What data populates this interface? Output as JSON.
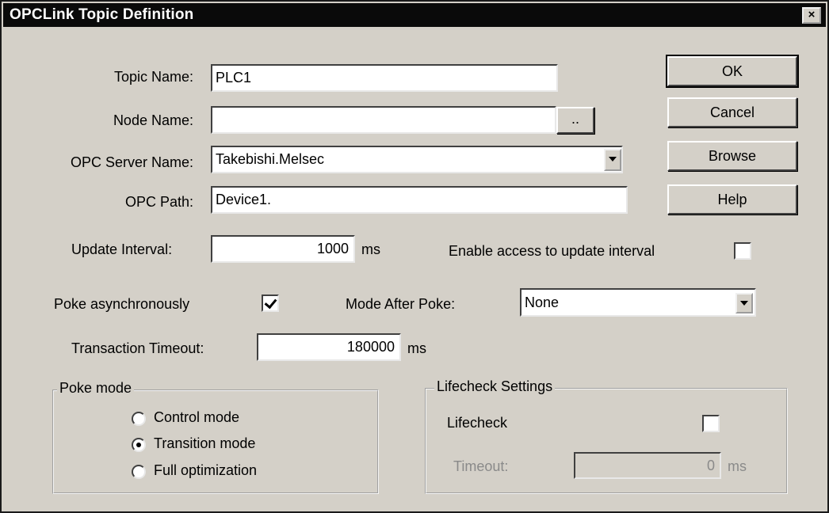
{
  "window": {
    "title": "OPCLink Topic Definition",
    "close_glyph": "×"
  },
  "fields": {
    "topic_name": {
      "label": "Topic Name:",
      "value": "PLC1"
    },
    "node_name": {
      "label": "Node Name:",
      "value": "",
      "browse_label": ".."
    },
    "opc_server_name": {
      "label": "OPC Server Name:",
      "value": "Takebishi.Melsec"
    },
    "opc_path": {
      "label": "OPC Path:",
      "value": "Device1."
    },
    "update_interval": {
      "label": "Update Interval:",
      "value": "1000",
      "unit": "ms"
    },
    "enable_access": {
      "label": "Enable access to update interval",
      "checked": false
    },
    "poke_async": {
      "label": "Poke asynchronously",
      "checked": true
    },
    "mode_after_poke": {
      "label": "Mode After Poke:",
      "value": "None"
    },
    "transaction_timeout": {
      "label": "Transaction Timeout:",
      "value": "180000",
      "unit": "ms"
    }
  },
  "buttons": {
    "ok": "OK",
    "cancel": "Cancel",
    "browse": "Browse",
    "help": "Help"
  },
  "poke_mode": {
    "title": "Poke mode",
    "options": [
      {
        "label": "Control mode",
        "selected": false
      },
      {
        "label": "Transition mode",
        "selected": true
      },
      {
        "label": "Full optimization",
        "selected": false
      }
    ]
  },
  "lifecheck": {
    "title": "Lifecheck Settings",
    "lifecheck_label": "Lifecheck",
    "lifecheck_checked": false,
    "timeout_label": "Timeout:",
    "timeout_value": "0",
    "timeout_unit": "ms"
  }
}
